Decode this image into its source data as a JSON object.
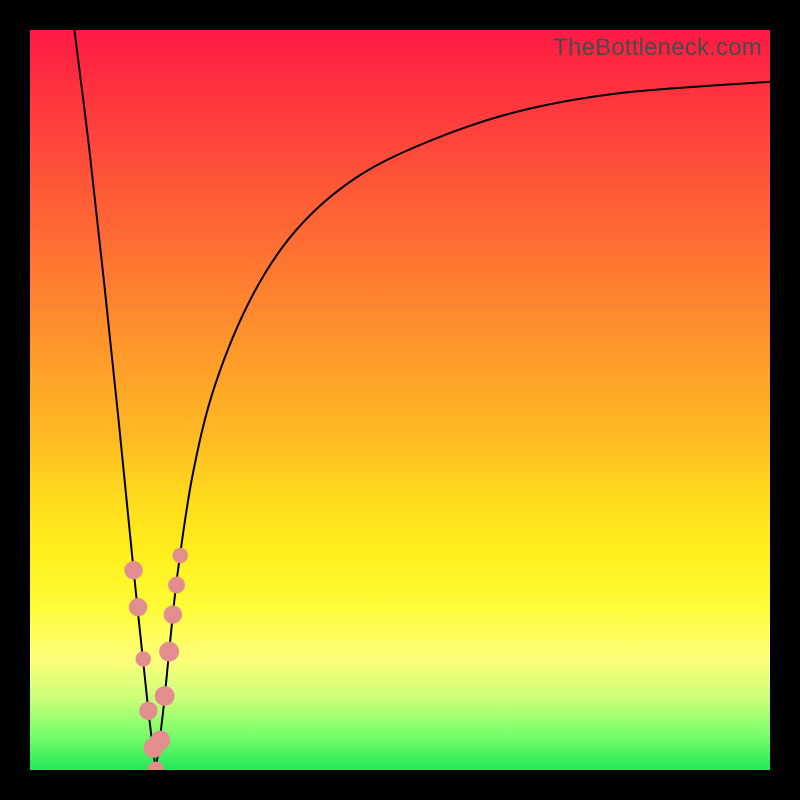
{
  "watermark": {
    "text": "TheBottleneck.com"
  },
  "colors": {
    "frame": "#000000",
    "curve_stroke": "#000000",
    "marker_fill": "#e38e8e",
    "gradient_stops": [
      "#ff1a44",
      "#ff3a3e",
      "#ff5a37",
      "#ff7a30",
      "#ff9a2a",
      "#ffba23",
      "#ffda1c",
      "#fff01c",
      "#fffc38",
      "#ffff7a",
      "#d0ff7a",
      "#7cff6a",
      "#24e858"
    ]
  },
  "chart_data": {
    "type": "line",
    "title": "",
    "xlabel": "",
    "ylabel": "",
    "xlim": [
      0,
      100
    ],
    "ylim": [
      0,
      100
    ],
    "grid": false,
    "curve_left": {
      "name": "left-branch",
      "x": [
        6,
        8,
        10,
        12,
        14,
        16,
        17
      ],
      "y": [
        100,
        84,
        66,
        47,
        27,
        8,
        0
      ]
    },
    "curve_right": {
      "name": "right-branch",
      "x": [
        17,
        18,
        19,
        20,
        22,
        25,
        30,
        36,
        44,
        54,
        66,
        80,
        100
      ],
      "y": [
        0,
        8,
        18,
        27,
        40,
        52,
        64,
        73,
        80,
        85,
        89,
        91.5,
        93
      ]
    },
    "markers": {
      "name": "data-points",
      "points": [
        {
          "x": 14.0,
          "y": 27,
          "r": 1.4
        },
        {
          "x": 14.6,
          "y": 22,
          "r": 1.4
        },
        {
          "x": 15.3,
          "y": 15,
          "r": 1.0
        },
        {
          "x": 16.0,
          "y": 8,
          "r": 1.4
        },
        {
          "x": 16.7,
          "y": 3,
          "r": 1.6
        },
        {
          "x": 17.0,
          "y": 0,
          "r": 1.2
        },
        {
          "x": 17.6,
          "y": 4,
          "r": 1.6
        },
        {
          "x": 18.2,
          "y": 10,
          "r": 1.6
        },
        {
          "x": 18.8,
          "y": 16,
          "r": 1.6
        },
        {
          "x": 19.3,
          "y": 21,
          "r": 1.4
        },
        {
          "x": 19.8,
          "y": 25,
          "r": 1.2
        },
        {
          "x": 20.3,
          "y": 29,
          "r": 1.0
        }
      ]
    }
  }
}
